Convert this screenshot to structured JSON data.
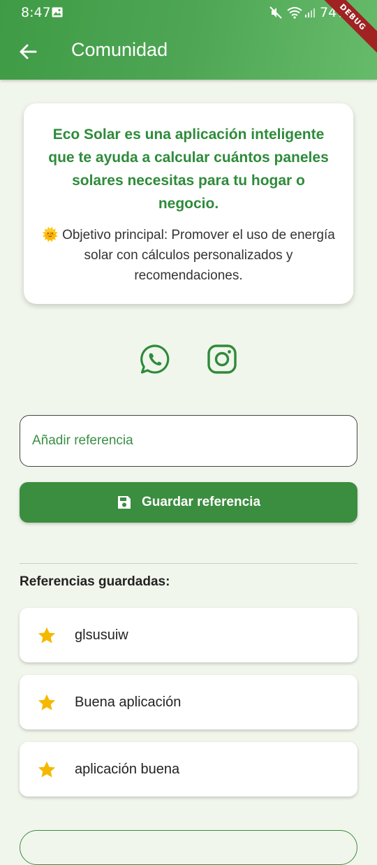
{
  "status_bar": {
    "time": "8:47",
    "battery": "74%",
    "debug_label": "DEBUG"
  },
  "appbar": {
    "title": "Comunidad"
  },
  "info": {
    "headline": "Eco Solar es una aplicación inteligente que te ayuda a calcular cuántos paneles solares necesitas para tu hogar o negocio.",
    "body": "🌞 Objetivo principal: Promover el uso de energía solar con cálculos personalizados y recomendaciones."
  },
  "social": {
    "icons": [
      "whatsapp-icon",
      "instagram-icon"
    ]
  },
  "reference_input": {
    "placeholder": "Añadir referencia",
    "value": ""
  },
  "save_button": {
    "label": "Guardar referencia",
    "icon": "save-icon"
  },
  "saved_refs": {
    "title": "Referencias guardadas:",
    "items": [
      {
        "label": "glsusuiw"
      },
      {
        "label": "Buena aplicación"
      },
      {
        "label": "aplicación buena"
      }
    ]
  },
  "colors": {
    "primary": "#3b8d3f",
    "accent_text": "#2e8b3a",
    "star": "#f5b800",
    "background": "#f1f6ec"
  }
}
